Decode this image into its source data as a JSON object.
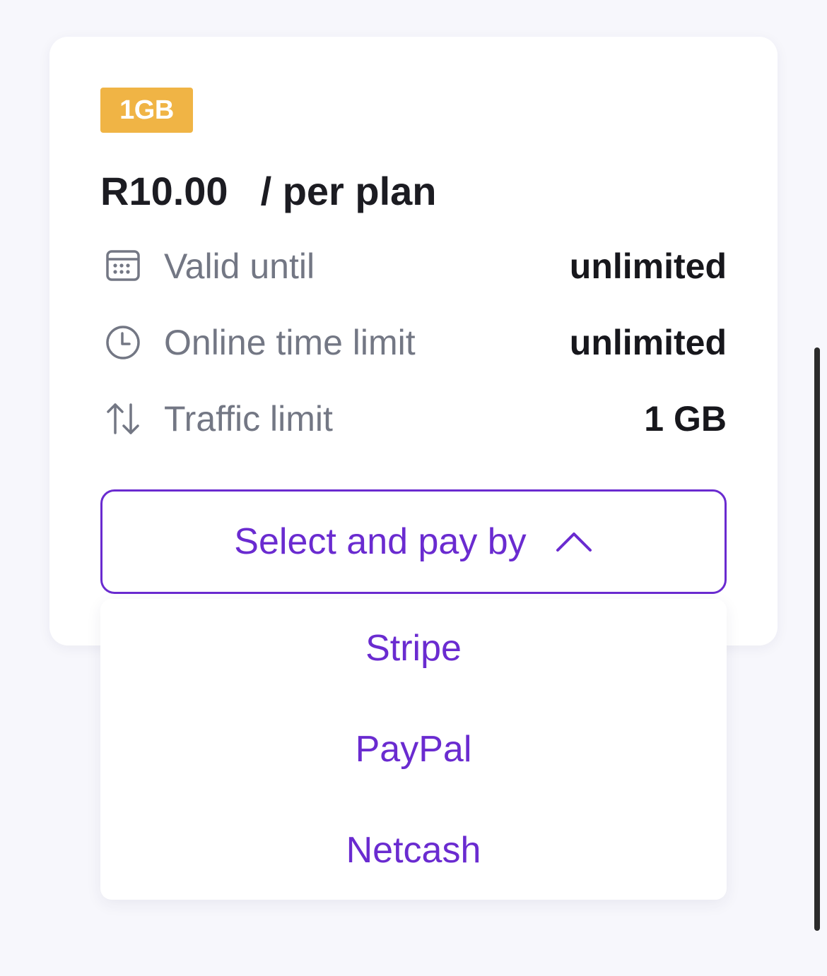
{
  "plan": {
    "badge": "1GB",
    "price": "R10.00",
    "price_unit": "/ per plan"
  },
  "details": [
    {
      "icon": "calendar-icon",
      "label": "Valid until",
      "value": "unlimited"
    },
    {
      "icon": "clock-icon",
      "label": "Online time limit",
      "value": "unlimited"
    },
    {
      "icon": "arrows-up-down-icon",
      "label": "Traffic limit",
      "value": "1 GB"
    }
  ],
  "payment": {
    "select_label": "Select and pay by",
    "expanded": true,
    "options": [
      "Stripe",
      "PayPal",
      "Netcash"
    ]
  },
  "colors": {
    "accent": "#6a2bd0",
    "badge": "#f0b445",
    "label_gray": "#737784",
    "value_dark": "#17171c"
  }
}
